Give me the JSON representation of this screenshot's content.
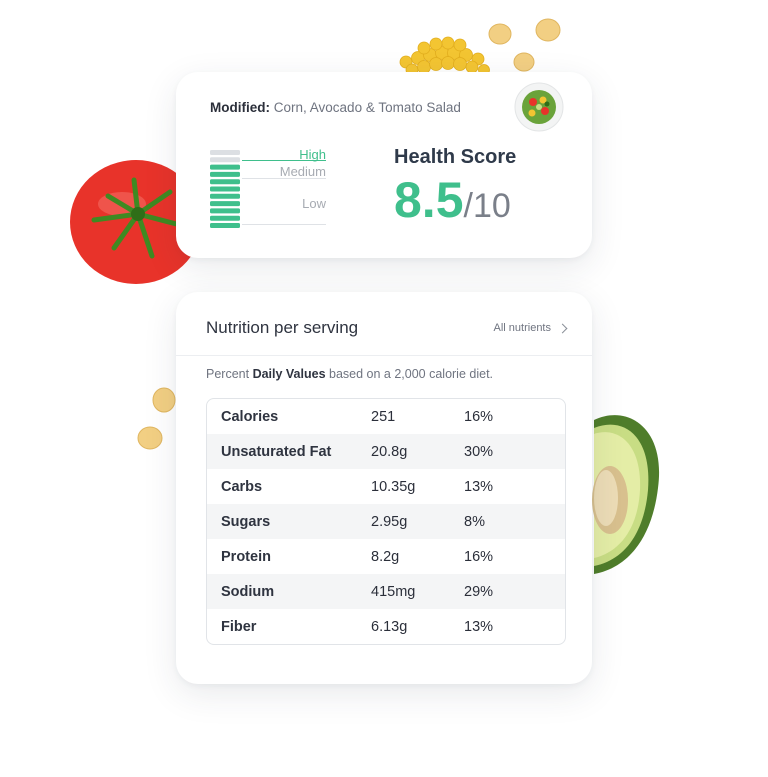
{
  "recipe": {
    "modified_label": "Modified:",
    "name": "Corn, Avocado & Tomato Salad"
  },
  "health": {
    "title": "Health Score",
    "score": "8.5",
    "out_of": "/10",
    "levels": {
      "high": "High",
      "medium": "Medium",
      "low": "Low"
    },
    "fill_fraction": 0.85
  },
  "nutrition": {
    "title": "Nutrition per serving",
    "all_nutrients_link": "All nutrients",
    "dv_prefix": "Percent ",
    "dv_bold": "Daily Values",
    "dv_suffix": " based on a 2,000 calorie diet.",
    "rows": [
      {
        "name": "Calories",
        "amount": "251",
        "percent": "16%"
      },
      {
        "name": "Unsaturated Fat",
        "amount": "20.8g",
        "percent": "30%"
      },
      {
        "name": "Carbs",
        "amount": "10.35g",
        "percent": "13%"
      },
      {
        "name": "Sugars",
        "amount": "2.95g",
        "percent": "8%"
      },
      {
        "name": "Protein",
        "amount": "8.2g",
        "percent": "16%"
      },
      {
        "name": "Sodium",
        "amount": "415mg",
        "percent": "29%"
      },
      {
        "name": "Fiber",
        "amount": "6.13g",
        "percent": "13%"
      }
    ]
  },
  "colors": {
    "accent_green": "#3fbf8c",
    "text_dark": "#2f3a4a",
    "muted": "#7a7f89"
  },
  "icons": [
    "salad-bowl-icon",
    "chevron-right-icon",
    "tomato-icon",
    "avocado-icon",
    "corn-icon",
    "chickpea-icon"
  ]
}
